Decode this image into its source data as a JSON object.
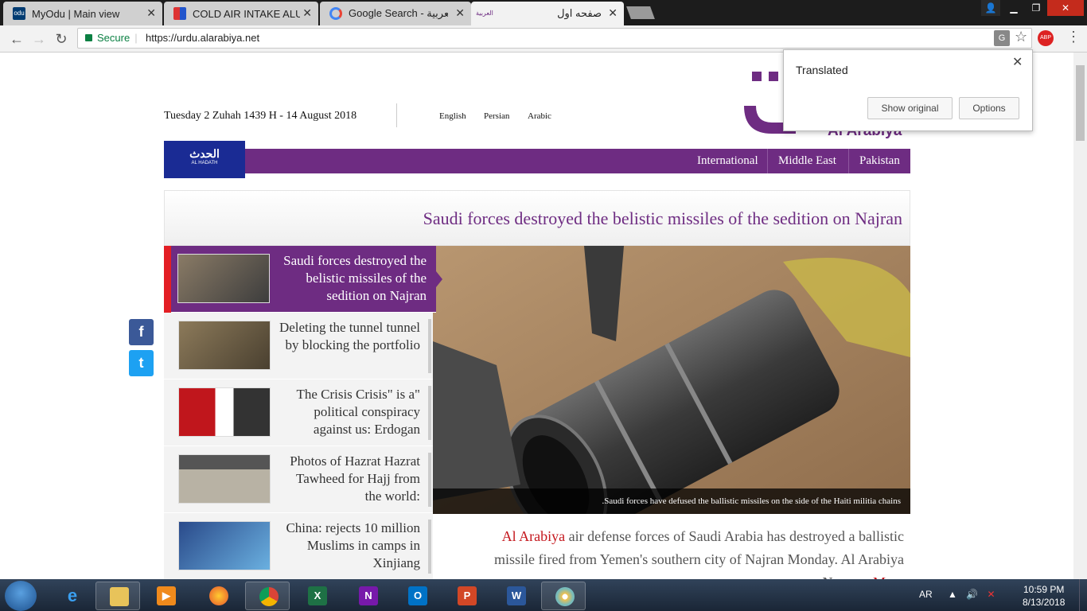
{
  "browser": {
    "tabs": [
      {
        "title": "MyOdu | Main view",
        "favicon": "odu-icon"
      },
      {
        "title": "COLD AIR INTAKE ALUMI",
        "favicon": "store-icon"
      },
      {
        "title": "Google Search - العربية",
        "favicon": "google-icon"
      },
      {
        "title": "صفحه اول",
        "favicon": "alarabiya-icon",
        "active": true
      }
    ],
    "secure_label": "Secure",
    "url": "https://urdu.alarabiya.net",
    "window_controls": [
      "user",
      "minimize",
      "maximize",
      "close"
    ]
  },
  "translate_popup": {
    "title": "Translated",
    "show_original": "Show original",
    "options": "Options"
  },
  "site": {
    "date": "Tuesday 2 Zuhah 1439 H - 14 August 2018",
    "languages": [
      "English",
      "Persian",
      "Arabic"
    ],
    "logo_text": "Al Arabiya",
    "hadath_label": "الحدث",
    "hadath_sub": "AL HADATH",
    "nav": [
      "International",
      "Middle East",
      "Pakistan"
    ],
    "headline": "Saudi forces destroyed the belistic missiles of the sedition on Najran",
    "caption": ".Saudi forces have defused the ballistic missiles on the side of the Haiti militia chains",
    "stories": [
      "Saudi forces destroyed the belistic missiles of the sedition on Najran",
      "Deleting the tunnel tunnel by blocking the portfolio",
      "The Crisis Crisis\" is a\" political conspiracy against us: Erdogan",
      "Photos of Hazrat Hazrat Tawheed for Hajj from the world:",
      "China: rejects 10 million Muslims in camps in Xinjiang"
    ],
    "article_source": "Al Arabiya",
    "article_text": " air defense forces of Saudi Arabia has destroyed a ballistic missile fired from Yemen's southern city of Najran Monday. Al Arabiya News ... ",
    "more": "More",
    "social": [
      "f",
      "t"
    ]
  },
  "taskbar": {
    "language": "AR",
    "time": "10:59 PM",
    "date": "8/13/2018"
  },
  "colors": {
    "purple": "#6e2c82",
    "hadath_blue": "#1a2b94",
    "red": "#e31e24"
  }
}
